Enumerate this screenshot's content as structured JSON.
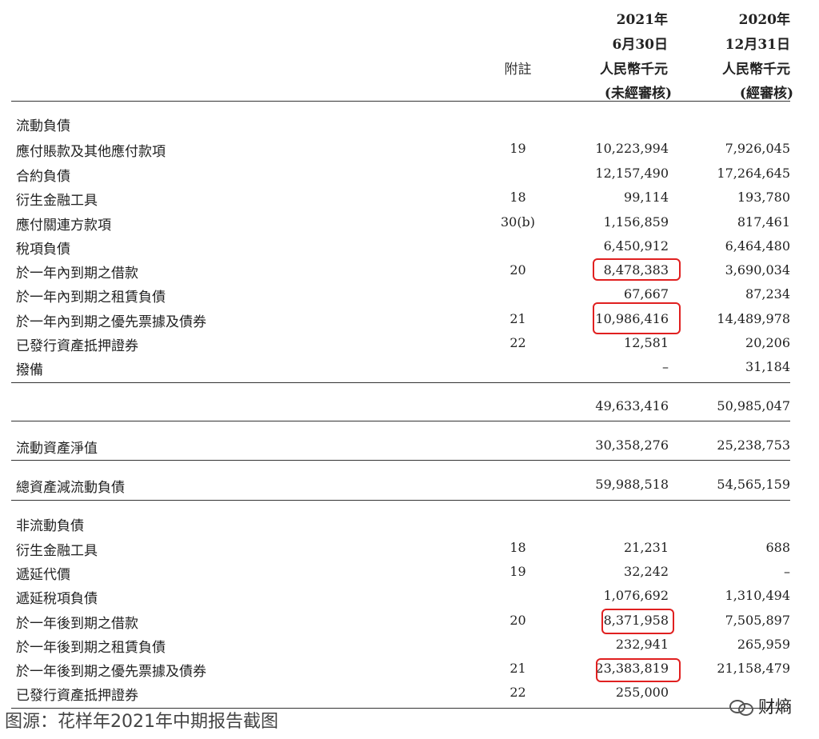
{
  "header": {
    "col1": {
      "year": "2021年",
      "date": "6月30日",
      "unit": "人民幣千元",
      "status": "(未經審核)"
    },
    "col2": {
      "year": "2020年",
      "date": "12月31日",
      "unit": "人民幣千元",
      "status": "(經審核)"
    },
    "note_label": "附註"
  },
  "rows": [
    {
      "label": "流動負債",
      "note": "",
      "v1": "",
      "v2": ""
    },
    {
      "label": "應付賬款及其他應付款項",
      "note": "19",
      "v1": "10,223,994",
      "v2": "7,926,045"
    },
    {
      "label": "合約負債",
      "note": "",
      "v1": "12,157,490",
      "v2": "17,264,645"
    },
    {
      "label": "衍生金融工具",
      "note": "18",
      "v1": "99,114",
      "v2": "193,780"
    },
    {
      "label": "應付關連方款項",
      "note": "30(b)",
      "v1": "1,156,859",
      "v2": "817,461"
    },
    {
      "label": "稅項負債",
      "note": "",
      "v1": "6,450,912",
      "v2": "6,464,480"
    },
    {
      "label": "於一年內到期之借款",
      "note": "20",
      "v1": "8,478,383",
      "v2": "3,690,034"
    },
    {
      "label": "於一年內到期之租賃負債",
      "note": "",
      "v1": "67,667",
      "v2": "87,234"
    },
    {
      "label": "於一年內到期之優先票據及債券",
      "note": "21",
      "v1": "10,986,416",
      "v2": "14,489,978"
    },
    {
      "label": "已發行資產抵押證券",
      "note": "22",
      "v1": "12,581",
      "v2": "20,206"
    },
    {
      "label": "撥備",
      "note": "",
      "v1": "–",
      "v2": "31,184"
    },
    {
      "label": "",
      "note": "",
      "v1": "49,633,416",
      "v2": "50,985,047"
    },
    {
      "label": "流動資產淨值",
      "note": "",
      "v1": "30,358,276",
      "v2": "25,238,753"
    },
    {
      "label": "總資產減流動負債",
      "note": "",
      "v1": "59,988,518",
      "v2": "54,565,159"
    },
    {
      "label": "非流動負債",
      "note": "",
      "v1": "",
      "v2": ""
    },
    {
      "label": "衍生金融工具",
      "note": "18",
      "v1": "21,231",
      "v2": "688"
    },
    {
      "label": "遞延代價",
      "note": "19",
      "v1": "32,242",
      "v2": "–"
    },
    {
      "label": "遞延稅項負債",
      "note": "",
      "v1": "1,076,692",
      "v2": "1,310,494"
    },
    {
      "label": "於一年後到期之借款",
      "note": "20",
      "v1": "8,371,958",
      "v2": "7,505,897"
    },
    {
      "label": "於一年後到期之租賃負債",
      "note": "",
      "v1": "232,941",
      "v2": "265,959"
    },
    {
      "label": "於一年後到期之優先票據及債券",
      "note": "21",
      "v1": "23,383,819",
      "v2": "21,158,479"
    },
    {
      "label": "已發行資產抵押證券",
      "note": "22",
      "v1": "255,000",
      "v2": ""
    }
  ],
  "caption": "图源：花样年2021年中期报告截图",
  "watermark": "财熵",
  "highlight_color": "#e02020"
}
